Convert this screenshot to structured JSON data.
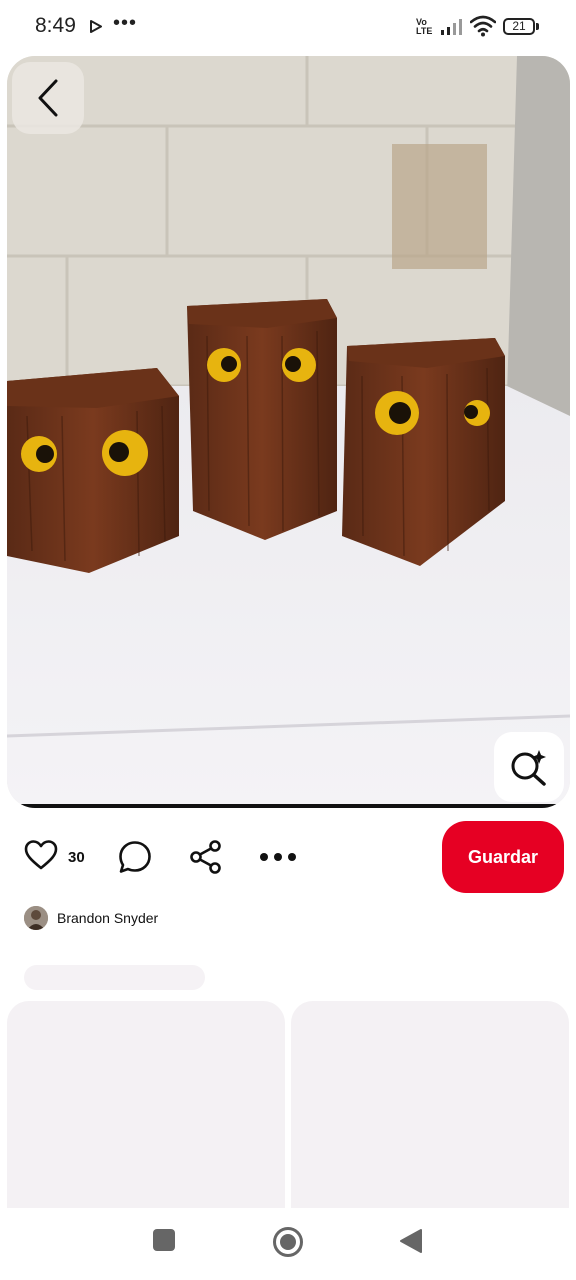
{
  "status_bar": {
    "time": "8:49",
    "network_label_top": "Vo",
    "network_label_bottom": "LTE",
    "battery": "21"
  },
  "pin": {
    "image_alt": "Three wooden block owls with yellow eyes on a white table",
    "back_icon": "chevron-left-icon",
    "lens_icon": "visual-search-icon"
  },
  "actions": {
    "like_count": "30",
    "like_icon": "heart-icon",
    "comment_icon": "comment-icon",
    "share_icon": "share-icon",
    "more_icon": "more-icon",
    "save_label": "Guardar"
  },
  "author": {
    "name": "Brandon Snyder"
  },
  "colors": {
    "accent": "#e60023",
    "skeleton": "#f4f1f4"
  },
  "navbar": {
    "recents_icon": "square-icon",
    "home_icon": "circle-home-icon",
    "back_icon": "triangle-back-icon"
  }
}
